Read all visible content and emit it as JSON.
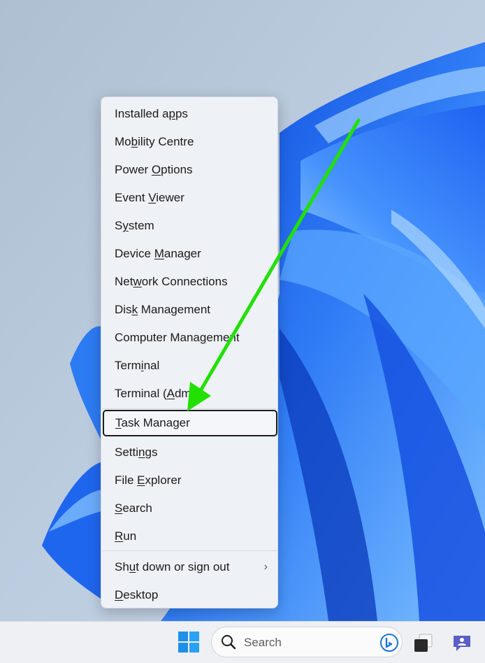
{
  "context_menu": {
    "items": [
      {
        "pre": "Installed a",
        "key": "p",
        "post": "ps"
      },
      {
        "pre": "Mo",
        "key": "b",
        "post": "ility Centre"
      },
      {
        "pre": "Power ",
        "key": "O",
        "post": "ptions"
      },
      {
        "pre": "Event ",
        "key": "V",
        "post": "iewer"
      },
      {
        "pre": "S",
        "key": "y",
        "post": "stem"
      },
      {
        "pre": "Device ",
        "key": "M",
        "post": "anager"
      },
      {
        "pre": "Net",
        "key": "w",
        "post": "ork Connections"
      },
      {
        "pre": "Dis",
        "key": "k",
        "post": " Management"
      },
      {
        "pre": "Computer Mana",
        "key": "g",
        "post": "ement"
      },
      {
        "pre": "Term",
        "key": "i",
        "post": "nal"
      },
      {
        "pre": "Terminal (",
        "key": "A",
        "post": "dmin)"
      },
      {
        "pre": "",
        "key": "T",
        "post": "ask Manager"
      },
      {
        "pre": "Setti",
        "key": "n",
        "post": "gs"
      },
      {
        "pre": "File ",
        "key": "E",
        "post": "xplorer"
      },
      {
        "pre": "",
        "key": "S",
        "post": "earch"
      },
      {
        "pre": "",
        "key": "R",
        "post": "un"
      },
      {
        "pre": "Sh",
        "key": "u",
        "post": "t down or sign out"
      },
      {
        "pre": "",
        "key": "D",
        "post": "esktop"
      }
    ],
    "submenu_chevron": "›"
  },
  "taskbar": {
    "search_label": "Search",
    "icons": [
      "windows-start-icon",
      "search-icon",
      "bing-icon",
      "task-view-icon",
      "teams-chat-icon"
    ]
  },
  "annotation": {
    "arrow_color": "#22e000",
    "focus_border_color": "#1c1c1c"
  }
}
